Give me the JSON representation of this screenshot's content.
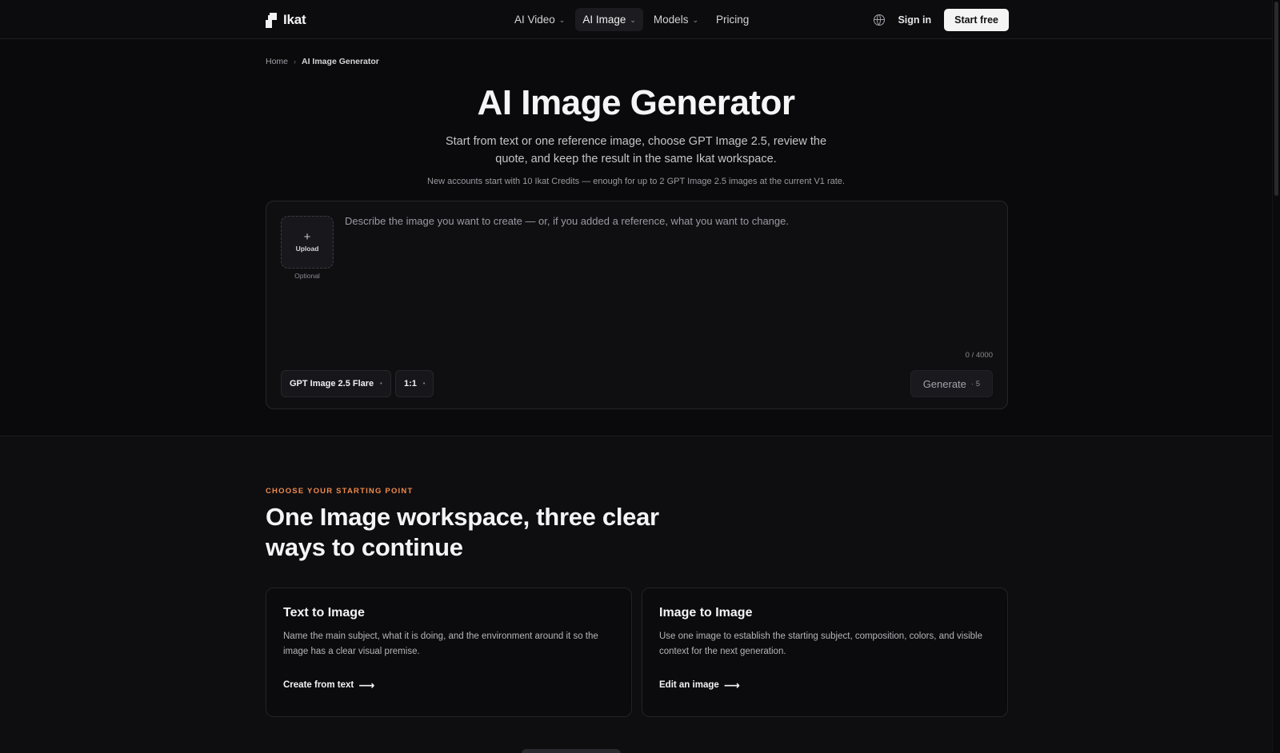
{
  "header": {
    "logo": "Ikat",
    "nav": [
      {
        "label": "AI Video",
        "has_dropdown": true,
        "active": false
      },
      {
        "label": "AI Image",
        "has_dropdown": true,
        "active": true
      },
      {
        "label": "Models",
        "has_dropdown": true,
        "active": false
      },
      {
        "label": "Pricing",
        "has_dropdown": false,
        "active": false
      }
    ],
    "language_icon": "globe-icon",
    "signin": "Sign in",
    "start_free": "Start free"
  },
  "breadcrumb": {
    "home": "Home",
    "current": "AI Image Generator"
  },
  "hero": {
    "title": "AI Image Generator",
    "subtitle": "Start from text or one reference image, choose GPT Image 2.5, review the quote, and keep the result in the same Ikat workspace.",
    "note": "New accounts start with 10 Ikat Credits — enough for up to 2 GPT Image 2.5 images at the current V1 rate."
  },
  "composer": {
    "upload_label": "Upload",
    "upload_hint": "Optional",
    "prompt_placeholder": "Describe the image you want to create — or, if you added a reference, what you want to change.",
    "prompt_value": "",
    "counter": "0 / 4000",
    "model": "GPT Image 2.5 Flare",
    "ratio": "1:1",
    "generate_label": "Generate",
    "generate_cost": "5"
  },
  "section": {
    "eyebrow": "CHOOSE YOUR STARTING POINT",
    "title": "One Image workspace, three clear ways to continue",
    "cards": [
      {
        "title": "Text to Image",
        "body": "Name the main subject, what it is doing, and the environment around it so the image has a clear visual premise.",
        "link": "Create from text"
      },
      {
        "title": "Image to Image",
        "body": "Use one image to establish the starting subject, composition, colors, and visible context for the next generation.",
        "link": "Edit an image"
      }
    ]
  },
  "colors": {
    "background": "#0a0a0c",
    "accent": "#f08a4b",
    "primary_button": "#f4f4f5"
  }
}
